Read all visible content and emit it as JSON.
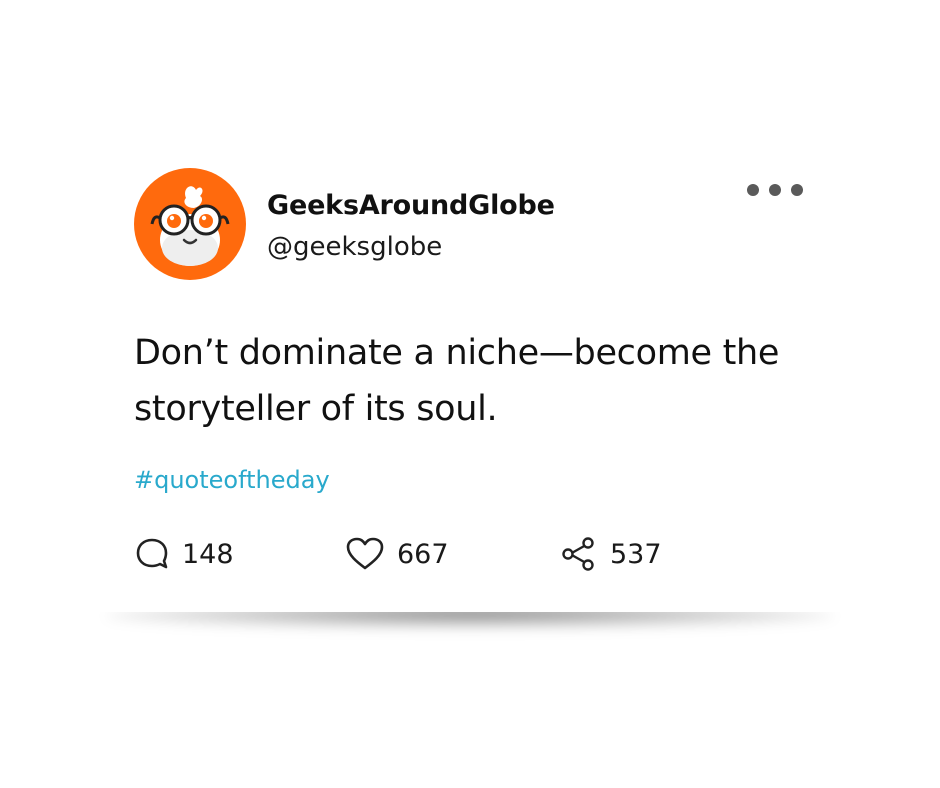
{
  "post": {
    "author": {
      "display_name": "GeeksAroundGlobe",
      "handle": "@geeksglobe",
      "avatar_icon": "mascot-avatar-icon",
      "avatar_color": "#ff6a0d"
    },
    "menu_icon": "more-horizontal-icon",
    "text": "Don’t dominate a niche—become the storyteller of its soul.",
    "hashtag": "#quoteoftheday",
    "hashtag_color": "#29a9cc",
    "actions": {
      "replies": {
        "icon": "comment-icon",
        "count": "148"
      },
      "likes": {
        "icon": "heart-icon",
        "count": "667"
      },
      "shares": {
        "icon": "share-icon",
        "count": "537"
      }
    }
  }
}
